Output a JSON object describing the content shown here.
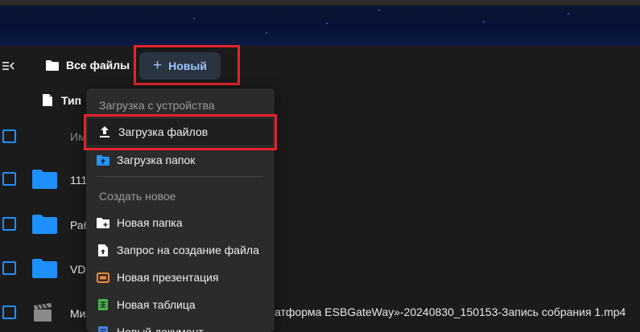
{
  "toolbar": {
    "breadcrumb_label": "Все файлы",
    "new_button_label": "Новый",
    "new_button_plus": "+"
  },
  "filters": {
    "type_label": "Тип"
  },
  "list": {
    "header_name_partial": "Им",
    "rows": [
      {
        "name": "111",
        "kind": "folder"
      },
      {
        "name": "Раб",
        "kind": "folder"
      },
      {
        "name": "VD",
        "kind": "folder"
      },
      {
        "name": "Ми",
        "kind": "video",
        "name_tail": "атформа ESBGateWay»-20240830_150153-Запись собрания 1.mp4"
      }
    ]
  },
  "new_menu": {
    "section_upload": "Загрузка с устройства",
    "upload_files": "Загрузка файлов",
    "upload_folders": "Загрузка папок",
    "section_create": "Создать новое",
    "new_folder": "Новая папка",
    "file_request": "Запрос на создание файла",
    "new_presentation": "Новая презентация",
    "new_spreadsheet": "Новая таблица",
    "new_document": "Новый документ"
  },
  "colors": {
    "accent_blue": "#1e90ff",
    "button_text": "#9cc6ff",
    "highlight_red": "#e3242b",
    "presentation_orange": "#f08a3c",
    "spreadsheet_green": "#4caf50",
    "document_blue": "#4a7fe0"
  }
}
